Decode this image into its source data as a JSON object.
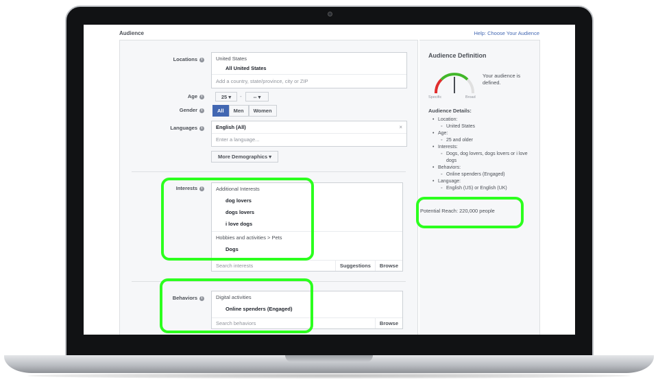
{
  "header": {
    "title": "Audience",
    "help": "Help: Choose Your Audience"
  },
  "locations": {
    "label": "Locations",
    "country": "United States",
    "selection": "All United States",
    "placeholder": "Add a country, state/province, city or ZIP"
  },
  "age": {
    "label": "Age",
    "min": "25",
    "max": "--"
  },
  "gender": {
    "label": "Gender",
    "options": [
      "All",
      "Men",
      "Women"
    ],
    "selected": "All"
  },
  "languages": {
    "label": "Languages",
    "selected": "English (All)",
    "placeholder": "Enter a language..."
  },
  "more_demographics": "More Demographics",
  "interests": {
    "label": "Interests",
    "group1": "Additional Interests",
    "items1": [
      "dog lovers",
      "dogs lovers",
      "i love dogs"
    ],
    "group2": "Hobbies and activities > Pets",
    "items2": [
      "Dogs"
    ],
    "placeholder": "Search interests",
    "suggestions": "Suggestions",
    "browse": "Browse"
  },
  "behaviors": {
    "label": "Behaviors",
    "group": "Digital activities",
    "item": "Online spenders (Engaged)",
    "placeholder": "Search behaviors",
    "browse": "Browse"
  },
  "definition": {
    "title": "Audience Definition",
    "note": "Your audience is defined.",
    "gauge_left": "Specific",
    "gauge_right": "Broad",
    "details_title": "Audience Details:",
    "details": [
      {
        "label": "Location:",
        "value": "United States"
      },
      {
        "label": "Age:",
        "value": "25 and older"
      },
      {
        "label": "Interests:",
        "value": "Dogs, dog lovers, dogs lovers or i love dogs"
      },
      {
        "label": "Behaviors:",
        "value": "Online spenders (Engaged)"
      },
      {
        "label": "Language:",
        "value": "English (US) or English (UK)"
      }
    ],
    "reach": "Potential Reach: 220,000 people"
  },
  "colors": {
    "accent": "#4267b2",
    "highlight": "#2cff1e"
  }
}
